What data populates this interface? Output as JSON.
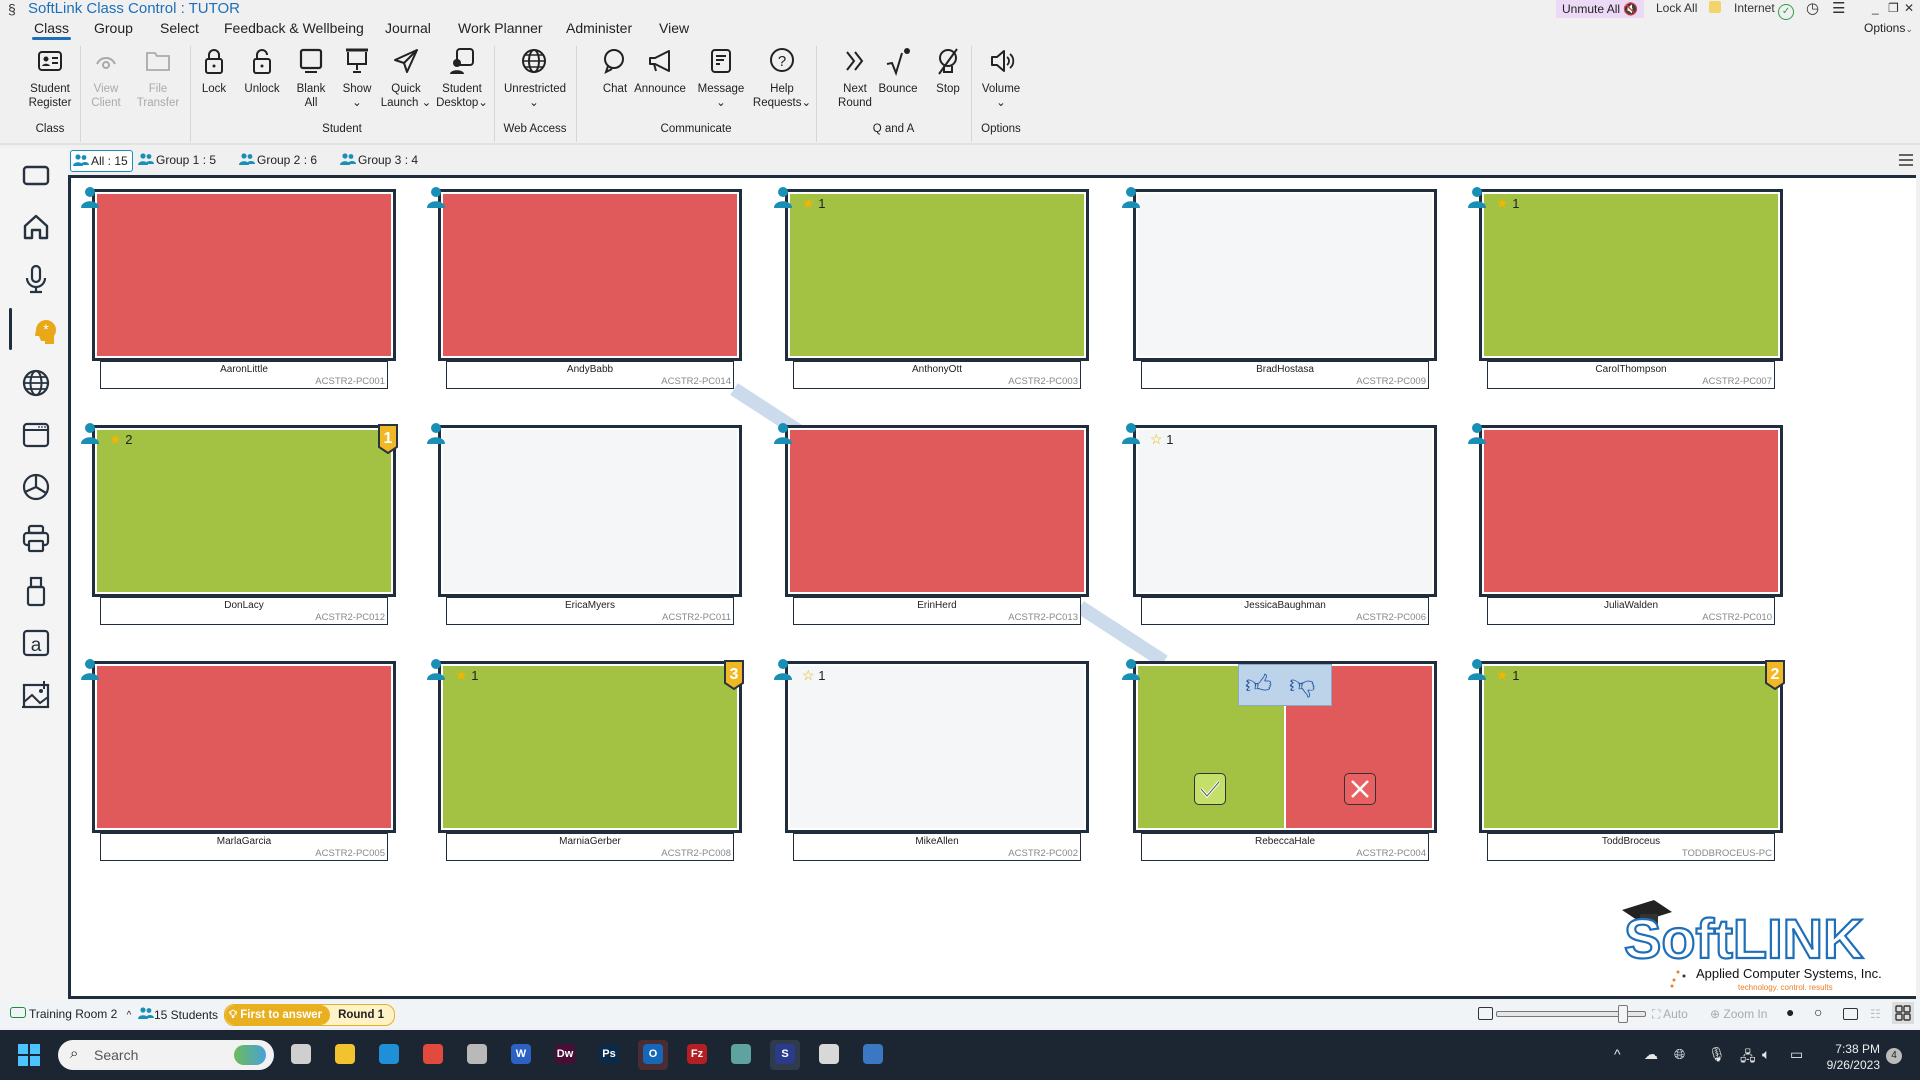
{
  "window": {
    "title": "SoftLink Class Control : TUTOR",
    "top_right": {
      "unmute_all": "Unmute All",
      "lock_all": "Lock All",
      "internet": "Internet",
      "options": "Options"
    }
  },
  "menu_tabs": [
    "Class",
    "Group",
    "Select",
    "Feedback & Wellbeing",
    "Journal",
    "Work Planner",
    "Administer",
    "View"
  ],
  "active_menu_tab": "Class",
  "ribbon": {
    "buttons": [
      {
        "label1": "Student",
        "label2": "Register",
        "icon": "id-card-icon"
      },
      {
        "label1": "View",
        "label2": "Client",
        "icon": "eye-icon",
        "disabled": true
      },
      {
        "label1": "File",
        "label2": "Transfer",
        "icon": "folder-icon",
        "disabled": true
      },
      {
        "label1": "Lock",
        "label2": "",
        "icon": "lock-icon"
      },
      {
        "label1": "Unlock",
        "label2": "",
        "icon": "unlock-icon"
      },
      {
        "label1": "Blank",
        "label2": "All",
        "icon": "monitor-icon"
      },
      {
        "label1": "Show",
        "label2": "⌄",
        "icon": "projector-icon"
      },
      {
        "label1": "Quick",
        "label2": "Launch ⌄",
        "icon": "send-icon"
      },
      {
        "label1": "Student",
        "label2": "Desktop⌄",
        "icon": "student-desktop-icon"
      },
      {
        "label1": "Unrestricted",
        "label2": "⌄",
        "icon": "globe-icon"
      },
      {
        "label1": "Chat",
        "label2": "",
        "icon": "chat-icon"
      },
      {
        "label1": "Announce",
        "label2": "",
        "icon": "megaphone-icon"
      },
      {
        "label1": "Message",
        "label2": "⌄",
        "icon": "message-icon"
      },
      {
        "label1": "Help",
        "label2": "Requests⌄",
        "icon": "help-icon"
      },
      {
        "label1": "Next",
        "label2": "Round",
        "icon": "double-chevron-icon"
      },
      {
        "label1": "Bounce",
        "label2": "",
        "icon": "bounce-icon"
      },
      {
        "label1": "Stop",
        "label2": "",
        "icon": "stop-icon"
      },
      {
        "label1": "Volume",
        "label2": "⌄",
        "icon": "volume-icon"
      }
    ],
    "groups": [
      "Class",
      "Student",
      "Web Access",
      "Communicate",
      "Q and A",
      "Options"
    ]
  },
  "group_tabs": [
    {
      "label": "All : 15",
      "active": true
    },
    {
      "label": "Group 1 : 5"
    },
    {
      "label": "Group 2 : 6"
    },
    {
      "label": "Group 3 : 4"
    }
  ],
  "sidebar_icons": [
    "screen-icon",
    "home-icon",
    "microphone-icon",
    "brain-idea-icon",
    "globe-icon",
    "browser-window-icon",
    "pie-chart-icon",
    "printer-icon",
    "usb-drive-icon",
    "font-a-icon",
    "image-icon"
  ],
  "students": [
    {
      "name": "AaronLittle",
      "pc": "ACSTR2-PC001",
      "status": "red"
    },
    {
      "name": "AndyBabb",
      "pc": "ACSTR2-PC014",
      "status": "red"
    },
    {
      "name": "AnthonyOtt",
      "pc": "ACSTR2-PC003",
      "status": "green",
      "stars": "1"
    },
    {
      "name": "BradHostasa",
      "pc": "ACSTR2-PC009",
      "status": "white"
    },
    {
      "name": "CarolThompson",
      "pc": "ACSTR2-PC007",
      "status": "green",
      "stars": "1"
    },
    {
      "name": "DonLacy",
      "pc": "ACSTR2-PC012",
      "status": "green",
      "stars": "2",
      "rank": "1"
    },
    {
      "name": "EricaMyers",
      "pc": "ACSTR2-PC011",
      "status": "white"
    },
    {
      "name": "ErinHerd",
      "pc": "ACSTR2-PC013",
      "status": "red"
    },
    {
      "name": "JessicaBaughman",
      "pc": "ACSTR2-PC006",
      "status": "white",
      "stars": "1",
      "star_outline": true
    },
    {
      "name": "JuliaWalden",
      "pc": "ACSTR2-PC010",
      "status": "red"
    },
    {
      "name": "MarlaGarcia",
      "pc": "ACSTR2-PC005",
      "status": "red"
    },
    {
      "name": "MarniaGerber",
      "pc": "ACSTR2-PC008",
      "status": "green",
      "stars": "1",
      "rank": "3"
    },
    {
      "name": "MikeAllen",
      "pc": "ACSTR2-PC002",
      "status": "white",
      "stars": "1",
      "star_outline": true
    },
    {
      "name": "RebeccaHale",
      "pc": "ACSTR2-PC004",
      "status": "split"
    },
    {
      "name": "ToddBroceus",
      "pc": "TODDBROCEUS-PC",
      "status": "green",
      "stars": "1",
      "rank": "2"
    }
  ],
  "colors": {
    "correct": "#a3c142",
    "incorrect": "#e05a5c",
    "unanswered": "#f4f6f7",
    "accent": "#1a8fb5",
    "gold": "#e8b020"
  },
  "logo": {
    "brand": "SoftLINK",
    "company": "Applied Computer Systems, Inc.",
    "tagline": "technology. control. results"
  },
  "statusbar": {
    "room": "Training Room 2",
    "students": "15 Students",
    "mode": "First to answer",
    "round": "Round 1",
    "auto": "Auto",
    "zoom_in": "Zoom In",
    "zoom_slider_value": 0.85
  },
  "taskbar": {
    "search_placeholder": "Search",
    "apps": [
      "task-view-icon",
      "file-explorer-icon",
      "edge-icon",
      "chrome-icon",
      "app-icon",
      "word-icon",
      "dreamweaver-icon",
      "photoshop-icon",
      "outlook-icon",
      "filezilla-icon",
      "network-app-icon",
      "softlink-icon",
      "box-icon",
      "calculator-icon"
    ],
    "time": "7:38 PM",
    "date": "9/26/2023",
    "notifications": "4"
  }
}
